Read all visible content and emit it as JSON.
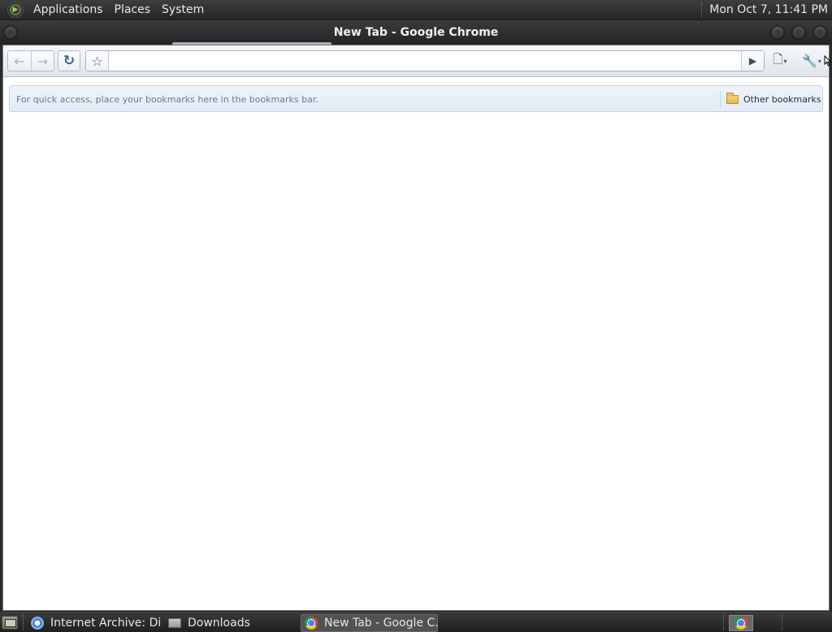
{
  "top_panel": {
    "menus": [
      "Applications",
      "Places",
      "System"
    ],
    "clock": "Mon Oct  7, 11:41 PM"
  },
  "window": {
    "title": "New Tab - Google Chrome"
  },
  "toolbar": {
    "back_icon": "←",
    "forward_icon": "→",
    "reload_icon": "↻",
    "star_icon": "☆",
    "go_icon": "▶",
    "page_menu_icon": "🗋",
    "wrench_icon": "🔧",
    "caret": "▾",
    "url_value": "",
    "url_placeholder": ""
  },
  "bookmarks_bar": {
    "hint": "For quick access, place your bookmarks here in the bookmarks bar.",
    "other_bookmarks": "Other bookmarks"
  },
  "taskbar": {
    "tasks": [
      {
        "label": "Internet Archive: Di...",
        "icon": "chromium-icon"
      },
      {
        "label": "Downloads",
        "icon": "folder-icon"
      },
      {
        "label": "New Tab - Google C...",
        "icon": "chrome-icon",
        "active": true
      }
    ]
  },
  "colors": {
    "panel_bg": "#2e2e2e",
    "toolbar_bg": "#e6ebf1",
    "bookmarks_bar_bg": "#e8f0f8",
    "accent_blue": "#3e5f92"
  }
}
